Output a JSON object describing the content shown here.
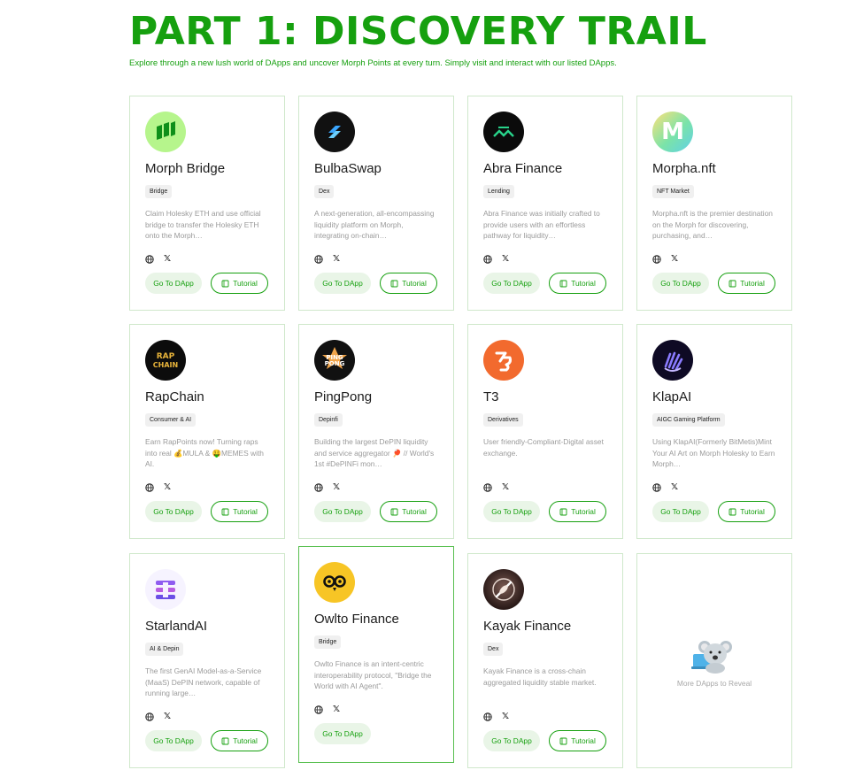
{
  "header": {
    "title": "PART 1: DISCOVERY TRAIL",
    "subtitle": "Explore through a new lush world of DApps and uncover Morph Points at every turn. Simply visit and interact with our listed DApps."
  },
  "buttons": {
    "go": "Go To DApp",
    "tutorial": "Tutorial"
  },
  "icons": {
    "website": "globe-icon",
    "twitter": "x-icon",
    "tutorial": "book-icon"
  },
  "colors": {
    "accent": "#16a00f",
    "card_border": "#cfe8cb",
    "button_bg": "#e9f5e7"
  },
  "dapps": [
    {
      "name": "Morph Bridge",
      "tag": "Bridge",
      "desc": "Claim Holesky ETH and use official bridge to transfer the Holesky ETH onto the Morph…",
      "logo": "morph-bridge-logo"
    },
    {
      "name": "BulbaSwap",
      "tag": "Dex",
      "desc": "A next-generation, all-encompassing liquidity platform on Morph, integrating on-chain…",
      "logo": "bulbaswap-logo"
    },
    {
      "name": "Abra Finance",
      "tag": "Lending",
      "desc": "Abra Finance was initially crafted to provide users with an effortless pathway for liquidity…",
      "logo": "abra-finance-logo"
    },
    {
      "name": "Morpha.nft",
      "tag": "NFT Market",
      "desc": "Morpha.nft is the premier destination on the Morph for discovering, purchasing, and…",
      "logo": "morpha-nft-logo"
    },
    {
      "name": "RapChain",
      "tag": "Consumer & AI",
      "desc": "Earn RapPoints now! Turning raps into real 💰MULA & 🤑MEMES with AI.",
      "logo": "rapchain-logo"
    },
    {
      "name": "PingPong",
      "tag": "Depinfi",
      "desc": "Building the largest DePIN liquidity and service aggregator 🏓 // World's 1st #DePINFi mon…",
      "logo": "pingpong-logo"
    },
    {
      "name": "T3",
      "tag": "Derivatives",
      "desc": "User friendly-Compliant-Digital asset exchange.",
      "logo": "t3-logo"
    },
    {
      "name": "KlapAI",
      "tag": "AIGC Gaming Platform",
      "desc": "Using KlapAI(Formerly BitMetis)Mint Your AI Art on Morph Holesky to Earn Morph…",
      "logo": "klapai-logo"
    },
    {
      "name": "StarlandAI",
      "tag": "AI & Depin",
      "desc": "The first GenAI Model-as-a-Service (MaaS) DePIN network, capable of running large…",
      "logo": "starlandai-logo"
    },
    {
      "name": "Owlto Finance",
      "tag": "Bridge",
      "desc": "Owlto Finance is an intent-centric interoperability protocol, \"Bridge the World with AI Agent\".",
      "logo": "owlto-finance-logo"
    },
    {
      "name": "Kayak Finance",
      "tag": "Dex",
      "desc": "Kayak Finance is a cross-chain aggregated liquidity stable market.",
      "logo": "kayak-finance-logo"
    }
  ],
  "more": {
    "label": "More DApps to Reveal",
    "icon": "koala-laptop-icon"
  }
}
